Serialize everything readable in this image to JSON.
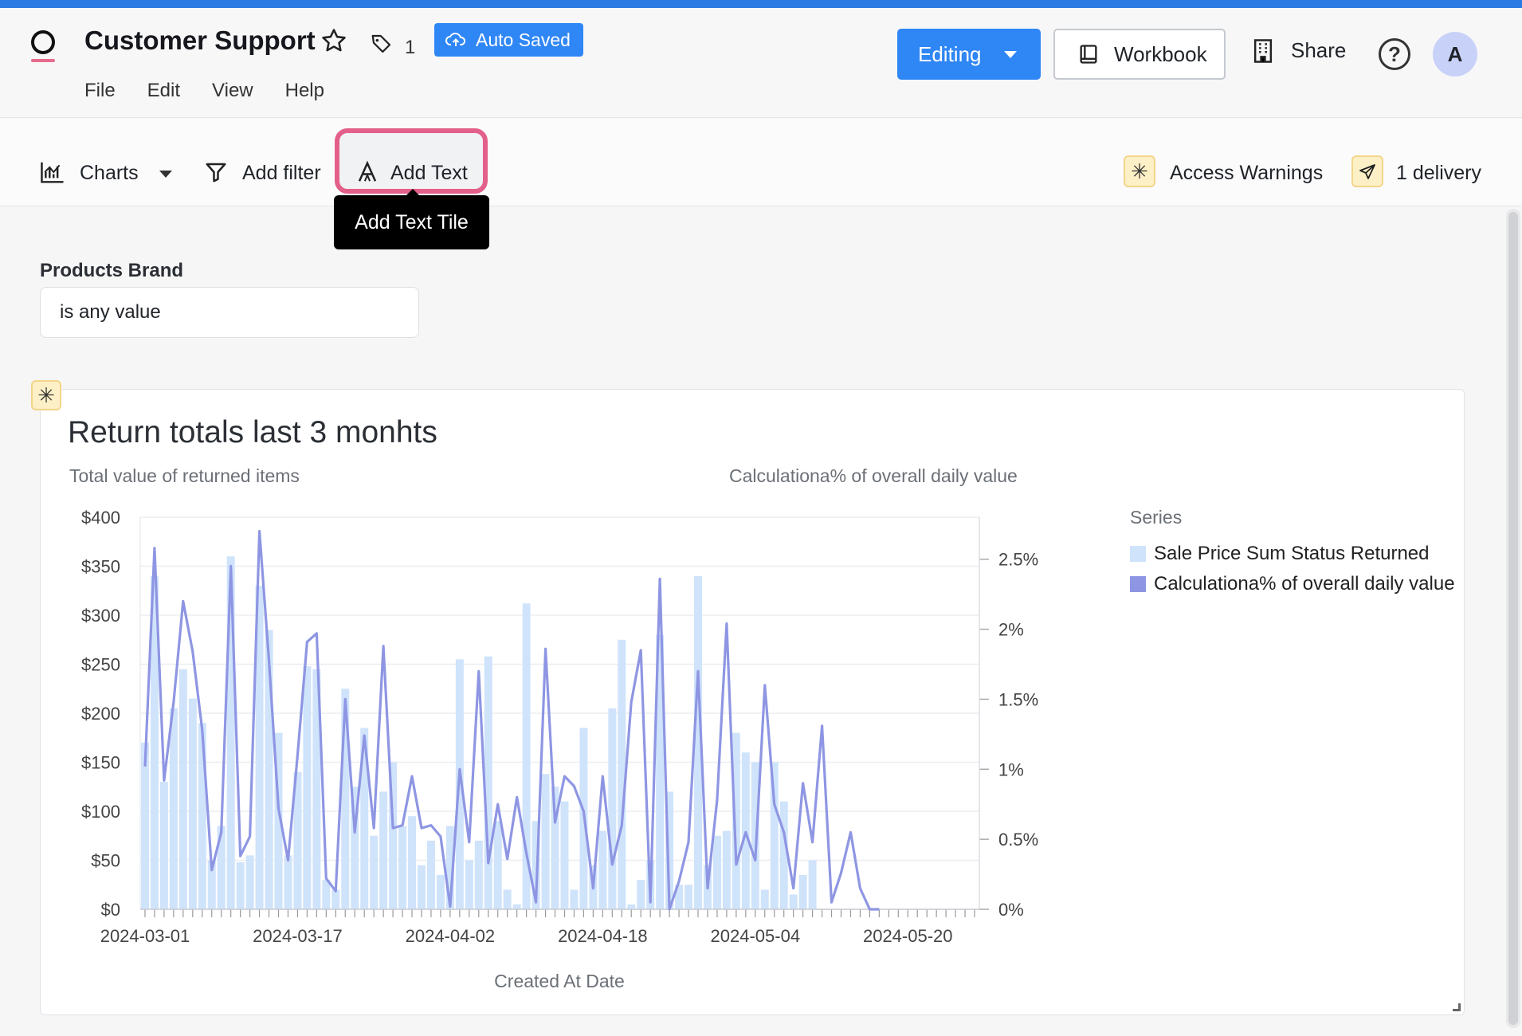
{
  "header": {
    "title": "Customer Support",
    "tag_count": "1",
    "autosaved_label": "Auto Saved",
    "menu": [
      "File",
      "Edit",
      "View",
      "Help"
    ],
    "editing_label": "Editing",
    "workbook_label": "Workbook",
    "share_label": "Share",
    "help_label": "?",
    "avatar_initial": "A"
  },
  "toolbar": {
    "charts_label": "Charts",
    "add_filter_label": "Add filter",
    "add_text_label": "Add Text",
    "tooltip": "Add Text Tile",
    "access_warnings_label": "Access Warnings",
    "delivery_label": "1 delivery"
  },
  "filter": {
    "label": "Products Brand",
    "value": "is any value"
  },
  "colors": {
    "accent": "#2f86f5",
    "highlight": "#e3608a",
    "bar": "#cfe3fb",
    "line": "#8e96e3"
  },
  "chart_data": {
    "type": "bar",
    "title": "Return totals last 3 monhts",
    "ylabel": "Total value of returned items",
    "y2label": "Calculationa% of overall daily value",
    "xlabel": "Created At Date",
    "ylim": [
      0,
      400
    ],
    "y2lim": [
      0,
      2.8
    ],
    "yticks": [
      "$0",
      "$50",
      "$100",
      "$150",
      "$200",
      "$250",
      "$300",
      "$350",
      "$400"
    ],
    "y2ticks": [
      "0%",
      "0.5%",
      "1%",
      "1.5%",
      "2%",
      "2.5%"
    ],
    "xticks": [
      "2024-03-01",
      "2024-03-17",
      "2024-04-02",
      "2024-04-18",
      "2024-05-04",
      "2024-05-20"
    ],
    "legend_title": "Series",
    "grid": true,
    "legend": "right",
    "series": [
      {
        "name": "Sale Price Sum Status Returned",
        "kind": "bar",
        "values": [
          170,
          340,
          130,
          205,
          245,
          215,
          190,
          50,
          85,
          360,
          48,
          55,
          330,
          285,
          180,
          55,
          140,
          248,
          245,
          30,
          20,
          225,
          125,
          185,
          75,
          120,
          150,
          85,
          95,
          45,
          70,
          35,
          85,
          255,
          50,
          70,
          258,
          90,
          20,
          5,
          312,
          90,
          138,
          125,
          110,
          20,
          185,
          45,
          80,
          205,
          275,
          5,
          30,
          50,
          280,
          120,
          25,
          25,
          340,
          45,
          75,
          80,
          180,
          160,
          150,
          20,
          150,
          110,
          15,
          35,
          50,
          0,
          0,
          0,
          0,
          0,
          0,
          0,
          0,
          0,
          0,
          0,
          0,
          0,
          0,
          0,
          0,
          0
        ]
      },
      {
        "name": "Calculationa% of overall daily value",
        "kind": "line",
        "values": [
          1.02,
          2.58,
          0.92,
          1.48,
          2.2,
          1.84,
          1.28,
          0.28,
          0.55,
          2.45,
          0.38,
          0.52,
          2.7,
          1.78,
          0.72,
          0.35,
          1.1,
          1.91,
          1.97,
          0.22,
          0.13,
          1.5,
          0.55,
          1.24,
          0.58,
          1.88,
          0.58,
          0.6,
          0.95,
          0.58,
          0.6,
          0.52,
          0.02,
          1.0,
          0.48,
          1.7,
          0.33,
          0.75,
          0.36,
          0.8,
          0.4,
          0.05,
          1.86,
          0.62,
          0.95,
          0.88,
          0.7,
          0.15,
          0.95,
          0.32,
          0.6,
          1.48,
          1.85,
          0.05,
          2.36,
          0.0,
          0.2,
          0.48,
          1.7,
          0.15,
          0.78,
          2.04,
          0.32,
          0.55,
          0.35,
          1.6,
          0.75,
          0.55,
          0.15,
          0.9,
          0.48,
          1.31,
          0.05,
          0.26,
          0.55,
          0.15,
          0.0,
          0.0,
          0.0,
          0.0,
          0.0,
          0.0,
          0.0,
          0.0,
          0.0,
          0.0,
          0.0,
          0.0
        ]
      }
    ],
    "n_ticks": 88
  }
}
